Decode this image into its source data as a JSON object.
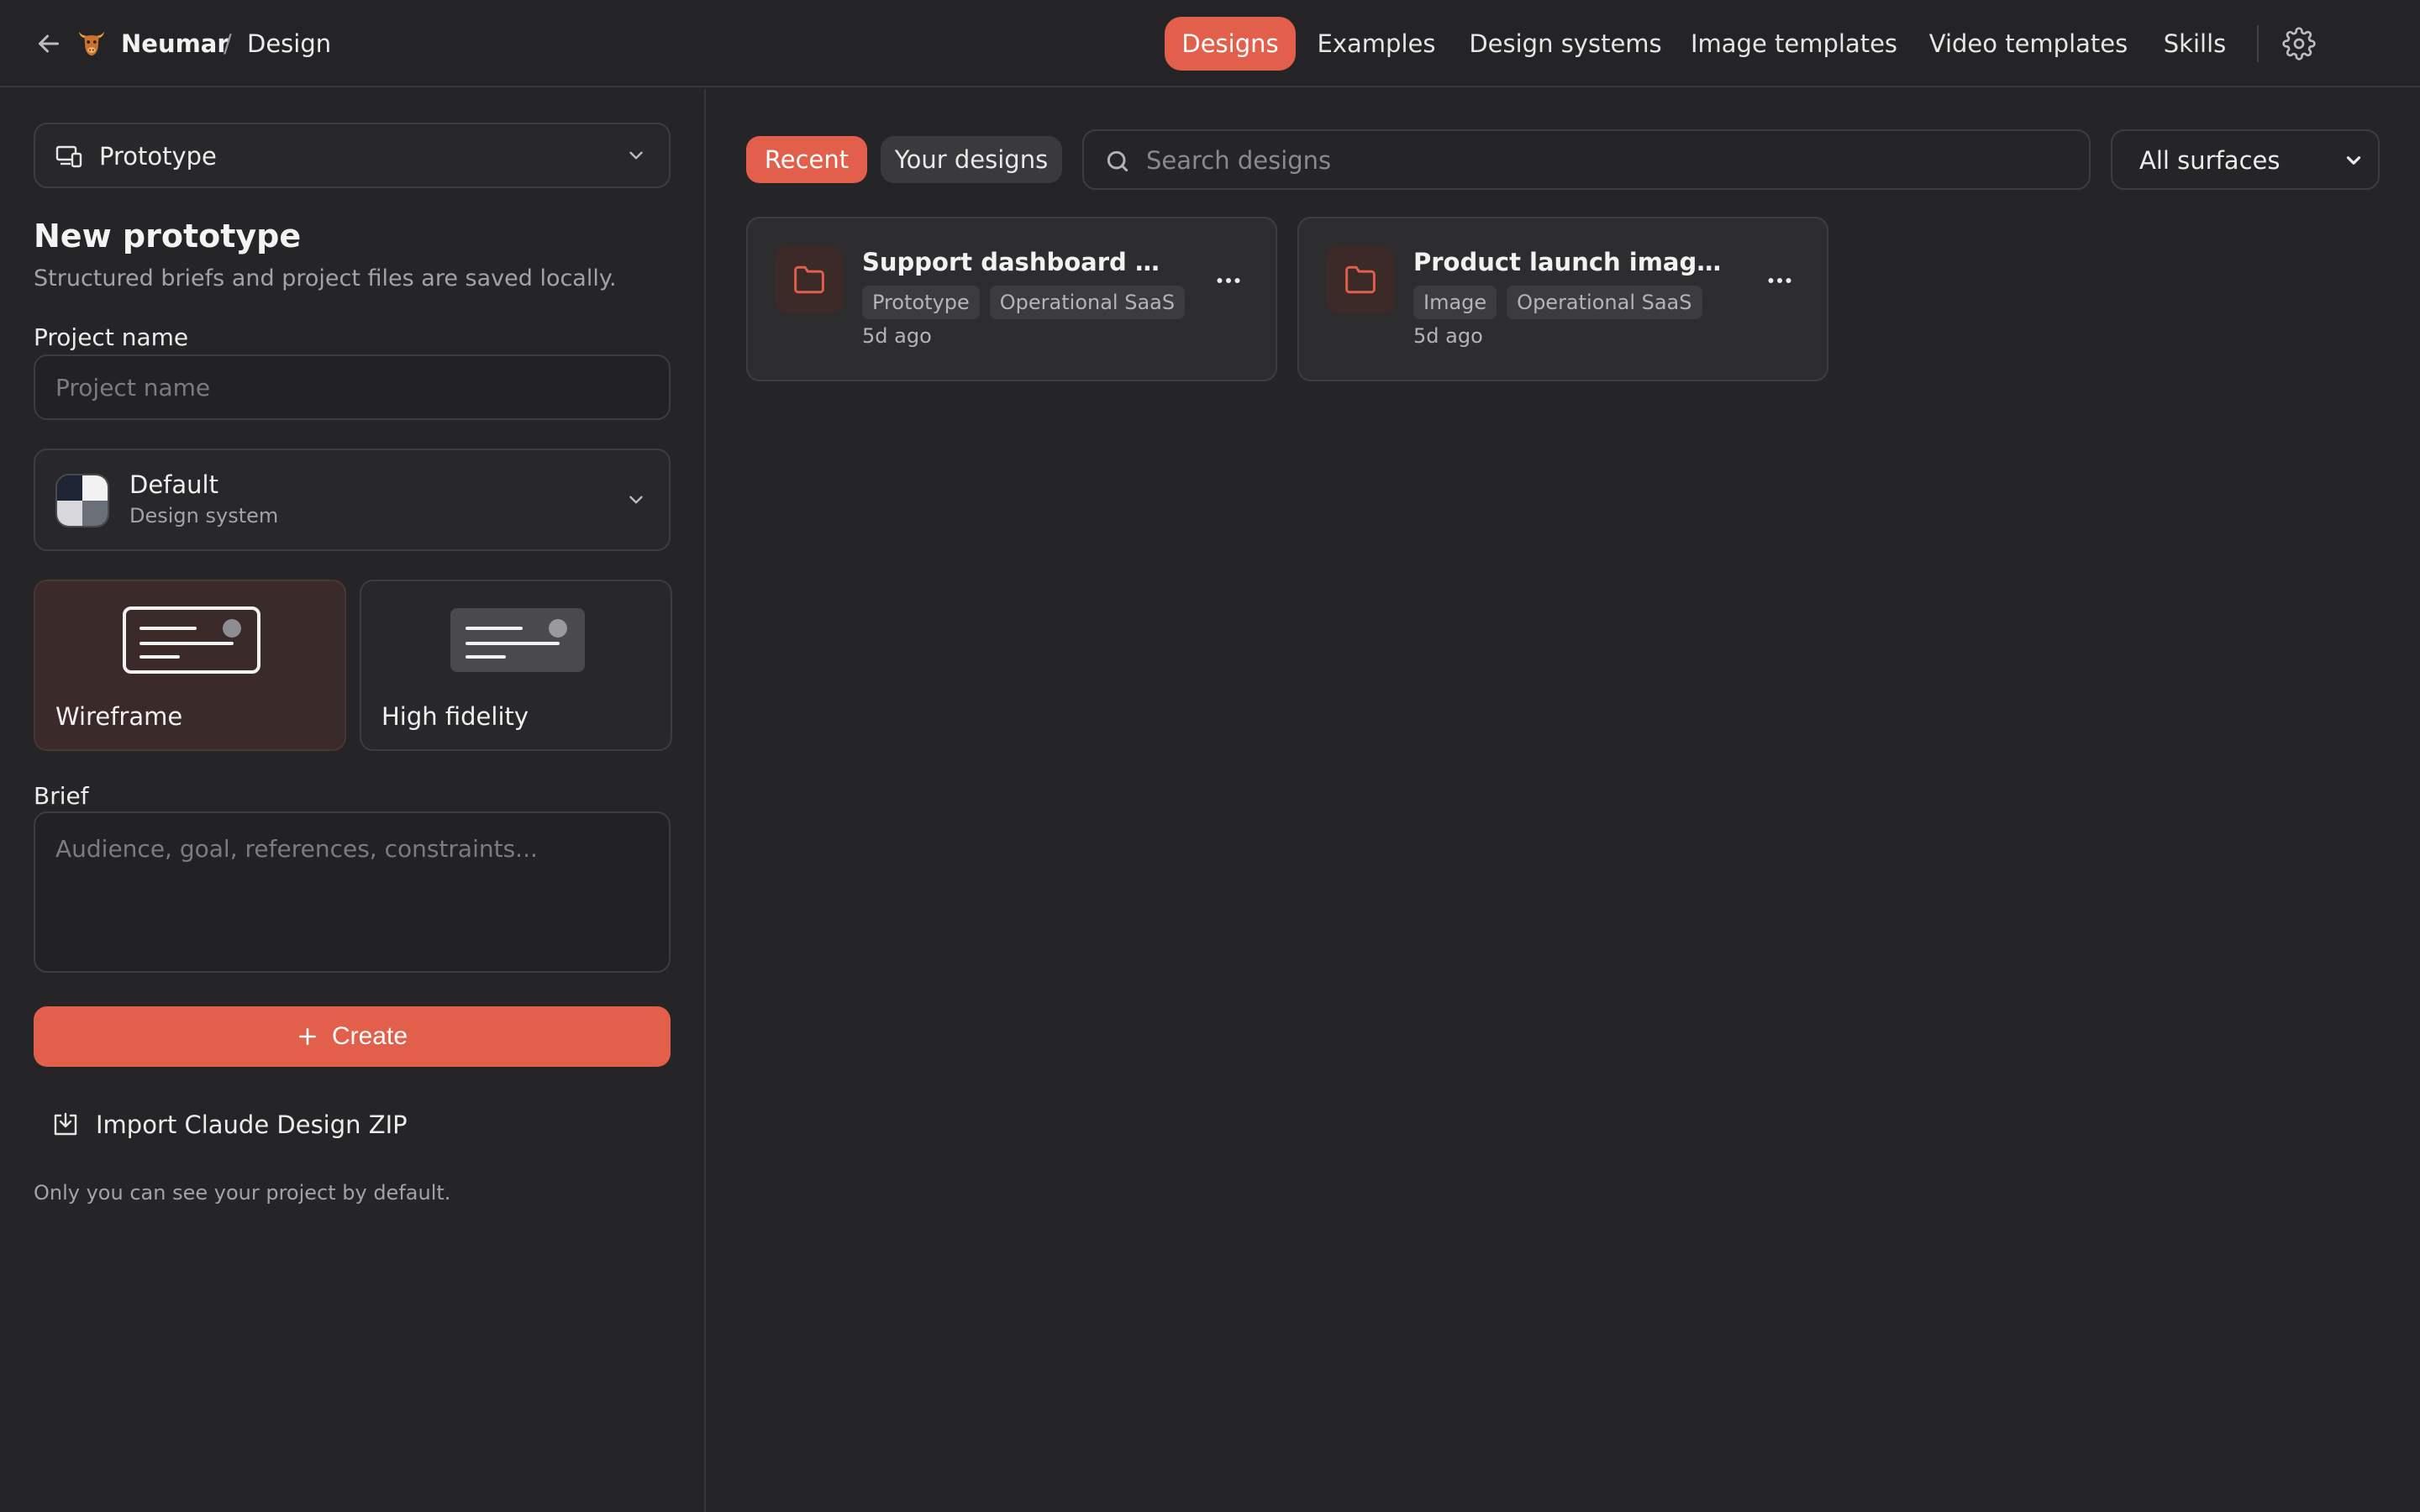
{
  "header": {
    "app_name": "Neumar",
    "separator": "/",
    "page_name": "Design",
    "nav": [
      {
        "label": "Designs",
        "active": true
      },
      {
        "label": "Examples",
        "active": false
      },
      {
        "label": "Design systems",
        "active": false
      },
      {
        "label": "Image templates",
        "active": false
      },
      {
        "label": "Video templates",
        "active": false
      },
      {
        "label": "Skills",
        "active": false
      }
    ],
    "icons": {
      "back": "arrow-left-icon",
      "logo": "bull-logo",
      "settings": "gear-icon"
    }
  },
  "sidebar": {
    "surface_select": {
      "value": "Prototype",
      "icon": "devices-icon"
    },
    "title": "New prototype",
    "subtitle": "Structured briefs and project files are saved locally.",
    "project_name_label": "Project name",
    "project_name_placeholder": "Project name",
    "project_name_value": "",
    "design_system": {
      "name": "Default",
      "sub": "Design system"
    },
    "fidelity": {
      "options": [
        {
          "label": "Wireframe",
          "selected": true
        },
        {
          "label": "High fidelity",
          "selected": false
        }
      ]
    },
    "brief_label": "Brief",
    "brief_placeholder": "Audience, goal, references, constraints...",
    "brief_value": "",
    "create_label": "Create",
    "import_label": "Import Claude Design ZIP",
    "footnote": "Only you can see your project by default."
  },
  "main": {
    "filter_tabs": [
      {
        "label": "Recent",
        "active": true
      },
      {
        "label": "Your designs",
        "active": false
      }
    ],
    "search_placeholder": "Search designs",
    "search_value": "",
    "surface_filter": "All surfaces",
    "designs": [
      {
        "title": "Support dashboard mockup",
        "tags": [
          "Prototype",
          "Operational SaaS"
        ],
        "time": "5d ago"
      },
      {
        "title": "Product launch image set",
        "tags": [
          "Image",
          "Operational SaaS"
        ],
        "time": "5d ago"
      }
    ]
  },
  "colors": {
    "accent": "#e2604b",
    "background": "#252527",
    "panel": "#2d2d30",
    "border": "#3d3d41",
    "muted_text": "#a3a3a7"
  }
}
